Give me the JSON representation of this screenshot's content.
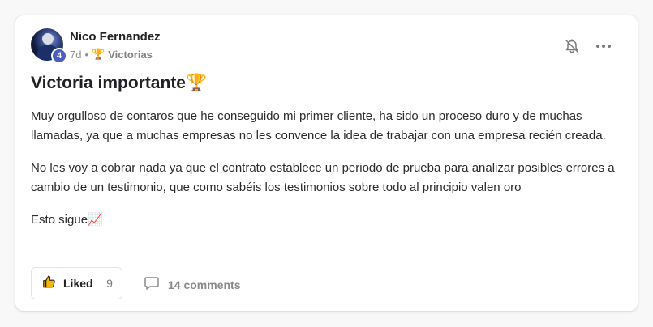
{
  "post": {
    "author_name": "Nico Fernandez",
    "author_level": "4",
    "time_ago": "7d",
    "separator": "•",
    "category_icon": "🏆",
    "category": "Victorias",
    "title": "Victoria importante🏆",
    "paragraphs": [
      "Muy orgulloso de contaros que he conseguido mi primer cliente, ha sido un proceso duro y de muchas llamadas, ya que a muchas empresas no les convence la idea de trabajar con una empresa recién creada.",
      "No les voy a cobrar nada ya que el contrato establece un periodo de prueba para analizar posibles errores a cambio de un testimonio, que como sabéis los testimonios sobre todo al principio valen oro",
      "Esto sigue📈"
    ]
  },
  "actions": {
    "like_label": "Liked",
    "like_count": "9",
    "comments_label": "14 comments"
  },
  "icons": {
    "notification": "bell-off-icon",
    "more": "more-options-icon",
    "like": "thumbs-up-icon",
    "comment": "comment-icon"
  },
  "colors": {
    "level_badge": "#4a5fc1",
    "muted_text": "#909090"
  }
}
